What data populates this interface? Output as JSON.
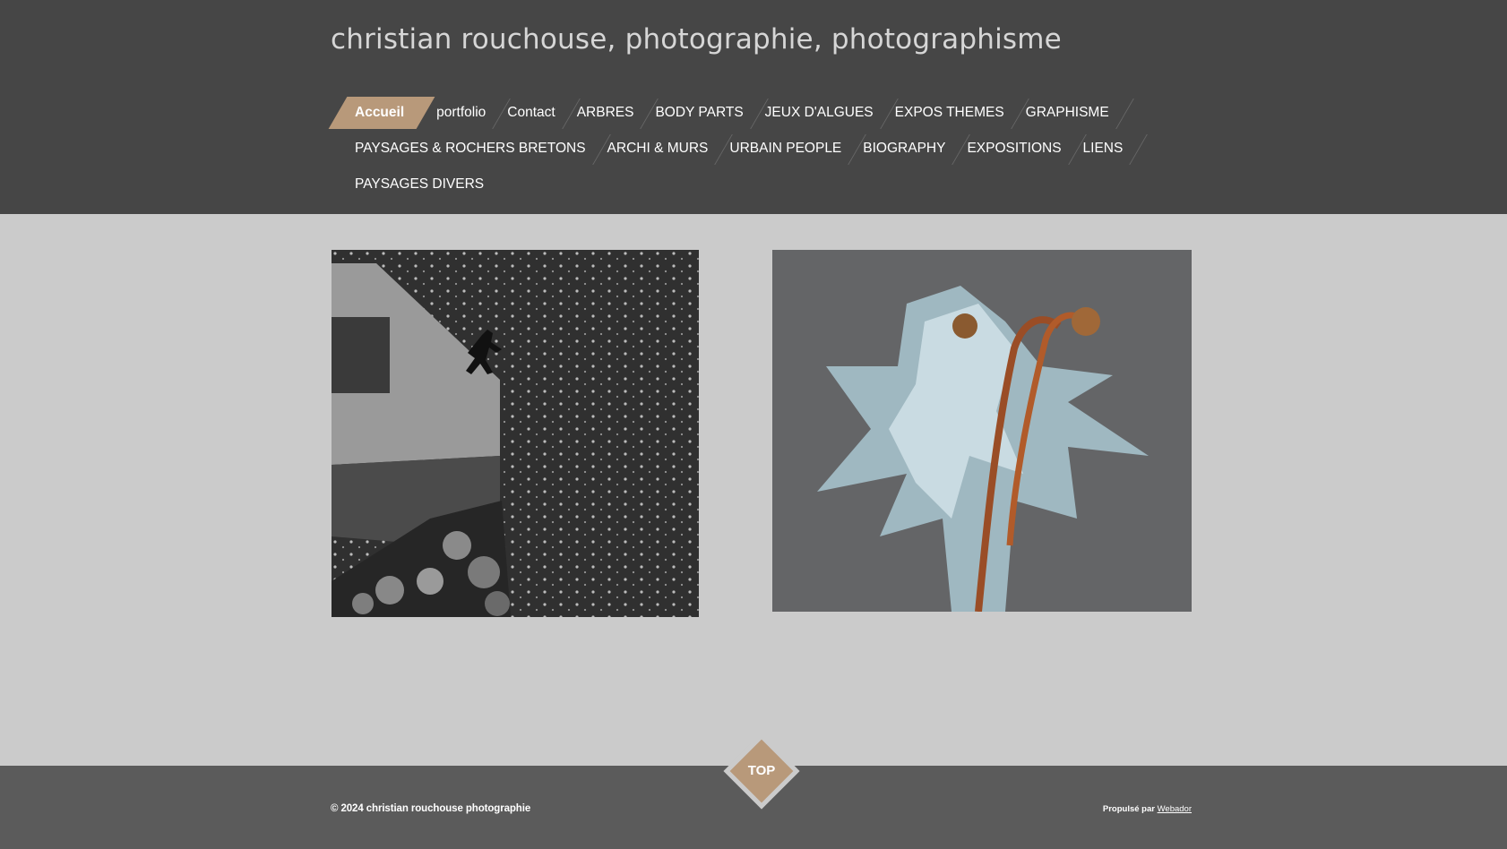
{
  "site": {
    "title": "christian rouchouse, photographie, photographisme"
  },
  "nav": {
    "rows": [
      [
        "Accueil",
        "portfolio",
        "Contact",
        "ARBRES",
        "BODY PARTS",
        "JEUX D'ALGUES",
        "EXPOS THEMES",
        "GRAPHISME"
      ],
      [
        "PAYSAGES & ROCHERS BRETONS",
        "ARCHI & MURS",
        "URBAIN PEOPLE",
        "BIOGRAPHY",
        "EXPOSITIONS",
        "LIENS"
      ],
      [
        "PAYSAGES DIVERS"
      ]
    ],
    "active": "Accueil"
  },
  "footer": {
    "copyright": "© 2024 christian rouchouse photographie",
    "powered_prefix": "Propulsé par",
    "powered_link": "Webador"
  },
  "top_button": {
    "label": "TOP"
  },
  "colors": {
    "header_bg": "#464646",
    "content_bg": "#cbcbcb",
    "footer_bg": "#5b5b5b",
    "accent": "#b8997a"
  }
}
